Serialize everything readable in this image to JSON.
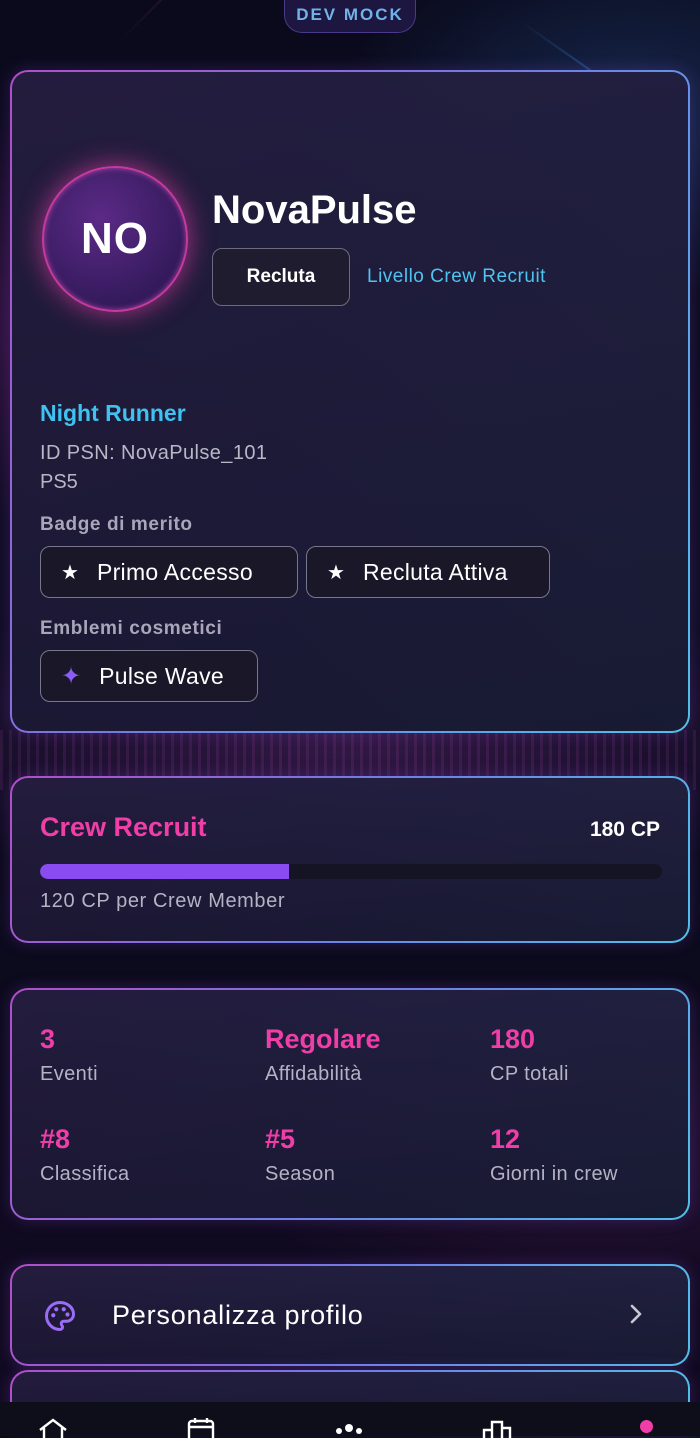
{
  "dev_badge": "DEV MOCK",
  "profile": {
    "initials": "NO",
    "username": "NovaPulse",
    "rank_button": "Recluta",
    "level_link": "Livello Crew Recruit",
    "crew_title": "Night Runner",
    "psn_id": "ID PSN: NovaPulse_101",
    "platform": "PS5",
    "badges_label": "Badge di merito",
    "badges": [
      {
        "icon": "star-icon",
        "label": "Primo Accesso"
      },
      {
        "icon": "star-icon",
        "label": "Recluta Attiva"
      }
    ],
    "emblems_label": "Emblemi cosmetici",
    "emblems": [
      {
        "icon": "sparkle-icon",
        "label": "Pulse Wave"
      }
    ]
  },
  "level": {
    "name": "Crew Recruit",
    "points": "180 CP",
    "progress_fraction": 0.4,
    "next_hint": "120 CP per Crew Member"
  },
  "stats": [
    {
      "value": "3",
      "label": "Eventi"
    },
    {
      "value": "Regolare",
      "label": "Affidabilità"
    },
    {
      "value": "180",
      "label": "CP totali"
    },
    {
      "value": "#8",
      "label": "Classifica"
    },
    {
      "value": "#5",
      "label": "Season"
    },
    {
      "value": "12",
      "label": "Giorni in crew"
    }
  ],
  "customize": {
    "icon": "palette-icon",
    "label": "Personalizza profilo"
  },
  "bottom_nav": [
    "home-icon",
    "calendar-icon",
    "crew-icon",
    "leaderboard-icon",
    "profile-icon"
  ],
  "colors": {
    "accent_pink": "#f03ea8",
    "accent_cyan": "#3fc2f0",
    "accent_purple": "#8a4cf0"
  }
}
